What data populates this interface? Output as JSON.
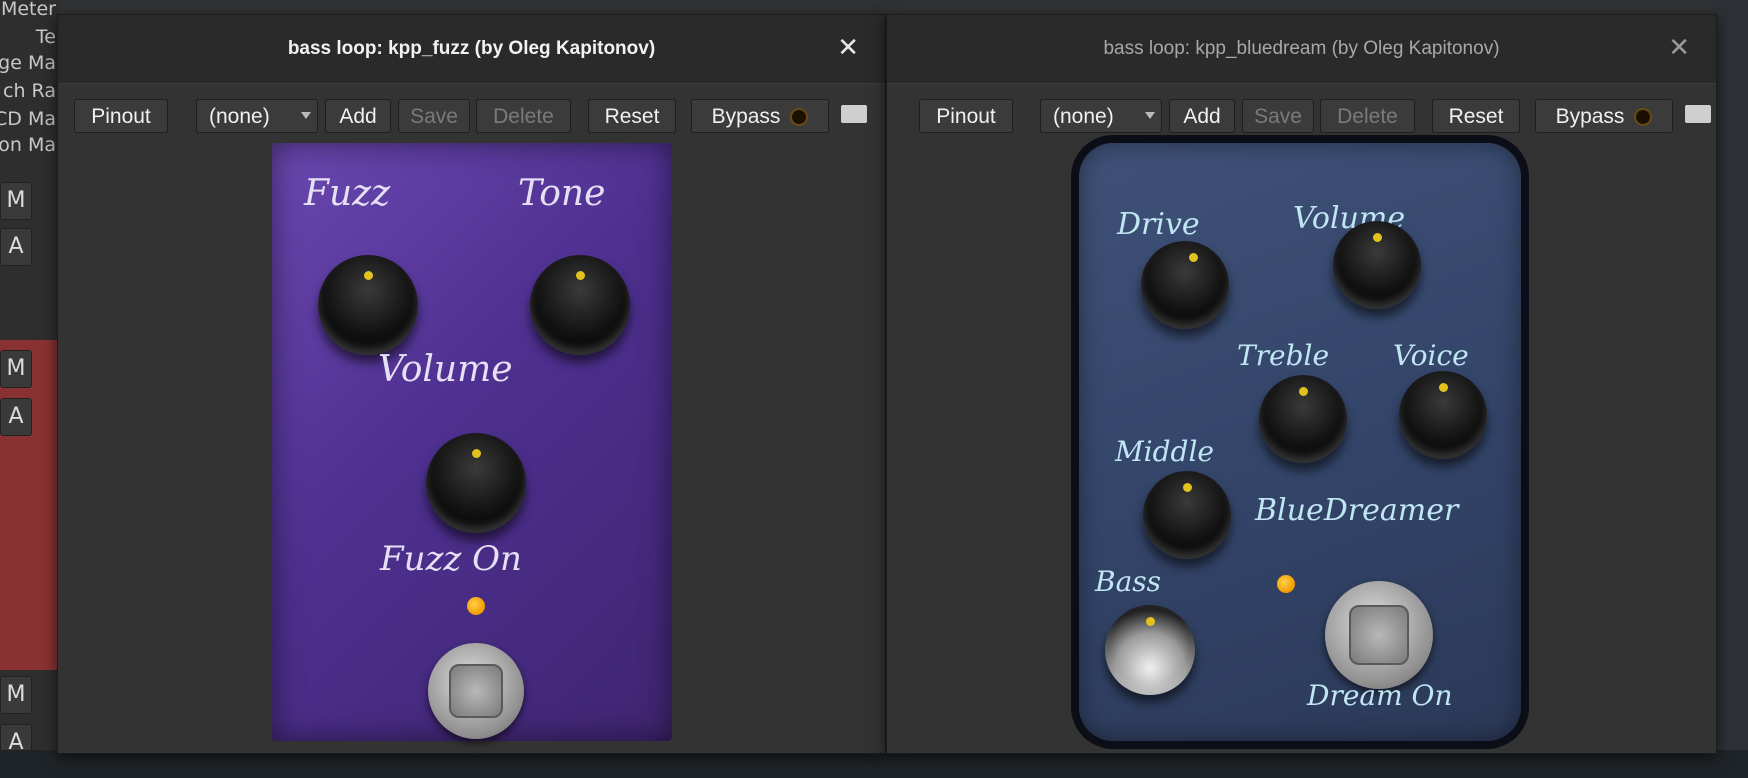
{
  "background": {
    "labels": [
      "Meter",
      "Te",
      "ge Ma",
      "ch Ra",
      "CD Ma",
      "on Ma"
    ],
    "buttons": [
      "M",
      "A",
      "M",
      "A",
      "M",
      "A"
    ]
  },
  "windows": [
    {
      "title": "bass loop: kpp_fuzz (by Oleg Kapitonov)",
      "toolbar": {
        "pinout": "Pinout",
        "preset": "(none)",
        "add": "Add",
        "save": "Save",
        "delete": "Delete",
        "reset": "Reset",
        "bypass": "Bypass"
      },
      "pedal": {
        "color": "#5b3a9c",
        "labels": [
          "Fuzz",
          "Tone",
          "Volume",
          "Fuzz On"
        ]
      }
    },
    {
      "title": "bass loop: kpp_bluedream (by Oleg Kapitonov)",
      "toolbar": {
        "pinout": "Pinout",
        "preset": "(none)",
        "add": "Add",
        "save": "Save",
        "delete": "Delete",
        "reset": "Reset",
        "bypass": "Bypass"
      },
      "pedal": {
        "color": "#34425f",
        "labels": [
          "Drive",
          "Volume",
          "Treble",
          "Voice",
          "Middle",
          "BlueDreamer",
          "Bass",
          "Dream On"
        ]
      }
    }
  ],
  "icons": {
    "close": "close-icon",
    "keyboard": "keyboard-icon"
  }
}
